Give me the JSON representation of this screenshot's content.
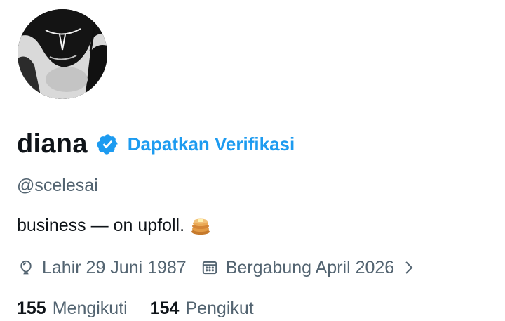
{
  "profile": {
    "display_name": "diana",
    "get_verified_label": "Dapatkan Verifikasi",
    "handle": "@scelesai",
    "bio": "business — on upfoll.",
    "bio_emoji": "pancakes-emoji",
    "birthday": "Lahir 29 Juni 1987",
    "joined": "Bergabung April 2026",
    "following_count": "155",
    "following_label": "Mengikuti",
    "followers_count": "154",
    "followers_label": "Pengikut"
  },
  "icons": {
    "verified": "verified-badge-icon",
    "birthday": "balloon-icon",
    "joined": "calendar-icon",
    "expand": "chevron-right-icon"
  },
  "colors": {
    "accent": "#1d9bf0",
    "text_primary": "#0f1419",
    "text_secondary": "#536471"
  }
}
